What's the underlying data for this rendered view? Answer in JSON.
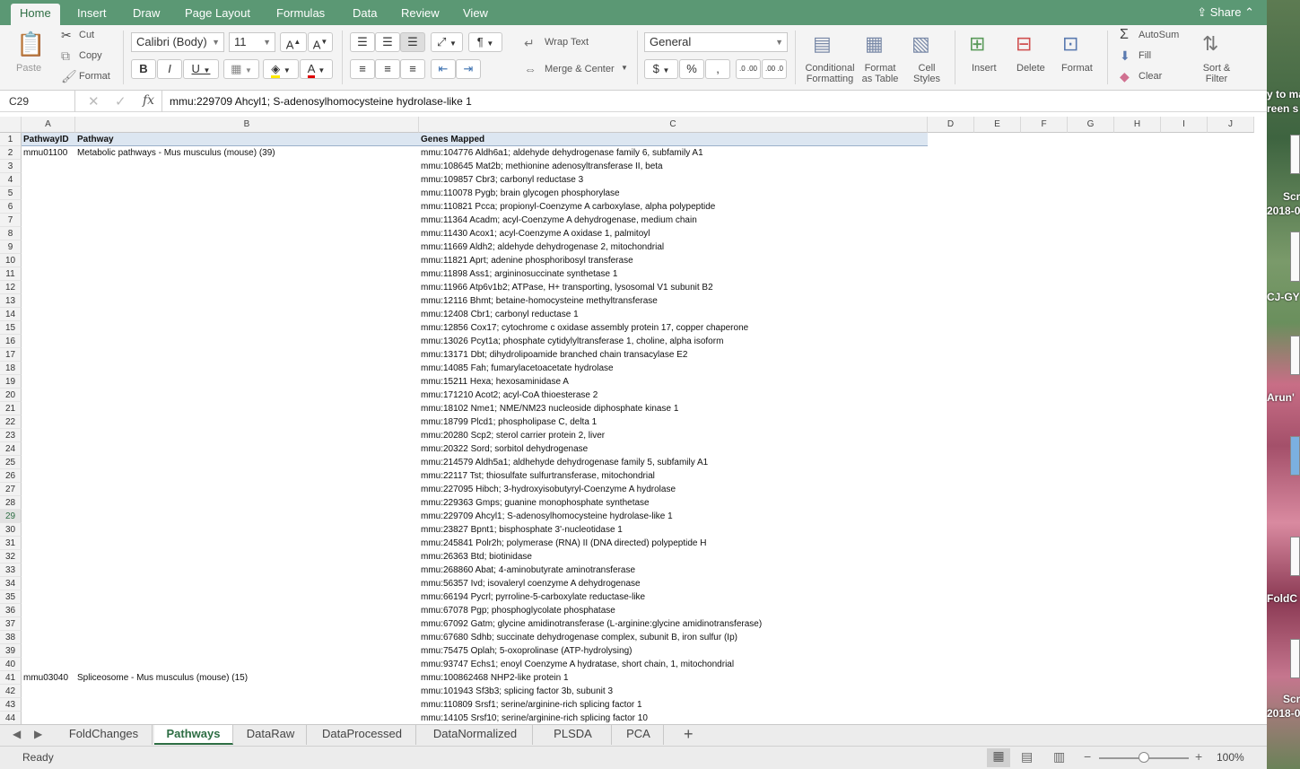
{
  "tabs": [
    "Home",
    "Insert",
    "Draw",
    "Page Layout",
    "Formulas",
    "Data",
    "Review",
    "View"
  ],
  "share": "Share",
  "ribbon": {
    "paste": "Paste",
    "cut": "Cut",
    "copy": "Copy",
    "format": "Format",
    "font_name": "Calibri (Body)",
    "font_size": "11",
    "wrap_text": "Wrap Text",
    "merge_center": "Merge & Center",
    "number_format": "General",
    "cond_fmt_1": "Conditional",
    "cond_fmt_2": "Formatting",
    "fmt_table_1": "Format",
    "fmt_table_2": "as Table",
    "cell_styles_1": "Cell",
    "cell_styles_2": "Styles",
    "insert": "Insert",
    "delete": "Delete",
    "format_cells": "Format",
    "autosum": "AutoSum",
    "fill": "Fill",
    "clear": "Clear",
    "sort_1": "Sort &",
    "sort_2": "Filter"
  },
  "formula_bar": {
    "name_box": "C29",
    "fx": "fx",
    "content": "mmu:229709 Ahcyl1; S-adenosylhomocysteine hydrolase-like 1"
  },
  "columns": [
    "A",
    "B",
    "C",
    "D",
    "E",
    "F",
    "G",
    "H",
    "I",
    "J"
  ],
  "header": {
    "a": "PathwayID",
    "b": "Pathway",
    "c": "Genes Mapped"
  },
  "rows": [
    {
      "n": "2",
      "a": "mmu01100",
      "b": "Metabolic pathways - Mus musculus (mouse) (39)",
      "c": "mmu:104776 Aldh6a1; aldehyde dehydrogenase family 6, subfamily A1"
    },
    {
      "n": "3",
      "a": "",
      "b": "",
      "c": "mmu:108645 Mat2b; methionine adenosyltransferase II, beta"
    },
    {
      "n": "4",
      "a": "",
      "b": "",
      "c": "mmu:109857 Cbr3; carbonyl reductase 3"
    },
    {
      "n": "5",
      "a": "",
      "b": "",
      "c": "mmu:110078 Pygb; brain glycogen phosphorylase"
    },
    {
      "n": "6",
      "a": "",
      "b": "",
      "c": "mmu:110821 Pcca; propionyl-Coenzyme A carboxylase, alpha polypeptide"
    },
    {
      "n": "7",
      "a": "",
      "b": "",
      "c": "mmu:11364 Acadm; acyl-Coenzyme A dehydrogenase, medium chain"
    },
    {
      "n": "8",
      "a": "",
      "b": "",
      "c": "mmu:11430 Acox1; acyl-Coenzyme A oxidase 1, palmitoyl"
    },
    {
      "n": "9",
      "a": "",
      "b": "",
      "c": "mmu:11669 Aldh2; aldehyde dehydrogenase 2, mitochondrial"
    },
    {
      "n": "10",
      "a": "",
      "b": "",
      "c": "mmu:11821 Aprt; adenine phosphoribosyl transferase"
    },
    {
      "n": "11",
      "a": "",
      "b": "",
      "c": "mmu:11898 Ass1; argininosuccinate synthetase 1"
    },
    {
      "n": "12",
      "a": "",
      "b": "",
      "c": "mmu:11966 Atp6v1b2; ATPase, H+ transporting, lysosomal V1 subunit B2"
    },
    {
      "n": "13",
      "a": "",
      "b": "",
      "c": "mmu:12116 Bhmt; betaine-homocysteine methyltransferase"
    },
    {
      "n": "14",
      "a": "",
      "b": "",
      "c": "mmu:12408 Cbr1; carbonyl reductase 1"
    },
    {
      "n": "15",
      "a": "",
      "b": "",
      "c": "mmu:12856 Cox17; cytochrome c oxidase assembly protein 17, copper chaperone"
    },
    {
      "n": "16",
      "a": "",
      "b": "",
      "c": "mmu:13026 Pcyt1a; phosphate cytidylyltransferase 1, choline, alpha isoform"
    },
    {
      "n": "17",
      "a": "",
      "b": "",
      "c": "mmu:13171 Dbt; dihydrolipoamide branched chain transacylase E2"
    },
    {
      "n": "18",
      "a": "",
      "b": "",
      "c": "mmu:14085 Fah; fumarylacetoacetate hydrolase"
    },
    {
      "n": "19",
      "a": "",
      "b": "",
      "c": "mmu:15211 Hexa; hexosaminidase A"
    },
    {
      "n": "20",
      "a": "",
      "b": "",
      "c": "mmu:171210 Acot2; acyl-CoA thioesterase 2"
    },
    {
      "n": "21",
      "a": "",
      "b": "",
      "c": "mmu:18102 Nme1; NME/NM23 nucleoside diphosphate kinase 1"
    },
    {
      "n": "22",
      "a": "",
      "b": "",
      "c": "mmu:18799 Plcd1; phospholipase C, delta 1"
    },
    {
      "n": "23",
      "a": "",
      "b": "",
      "c": "mmu:20280 Scp2; sterol carrier protein 2, liver"
    },
    {
      "n": "24",
      "a": "",
      "b": "",
      "c": "mmu:20322 Sord; sorbitol dehydrogenase"
    },
    {
      "n": "25",
      "a": "",
      "b": "",
      "c": "mmu:214579 Aldh5a1; aldhehyde dehydrogenase family 5, subfamily A1"
    },
    {
      "n": "26",
      "a": "",
      "b": "",
      "c": "mmu:22117 Tst; thiosulfate sulfurtransferase, mitochondrial"
    },
    {
      "n": "27",
      "a": "",
      "b": "",
      "c": "mmu:227095 Hibch; 3-hydroxyisobutyryl-Coenzyme A hydrolase"
    },
    {
      "n": "28",
      "a": "",
      "b": "",
      "c": "mmu:229363 Gmps; guanine monophosphate synthetase"
    },
    {
      "n": "29",
      "a": "",
      "b": "",
      "c": "mmu:229709 Ahcyl1; S-adenosylhomocysteine hydrolase-like 1"
    },
    {
      "n": "30",
      "a": "",
      "b": "",
      "c": "mmu:23827 Bpnt1; bisphosphate 3'-nucleotidase 1"
    },
    {
      "n": "31",
      "a": "",
      "b": "",
      "c": "mmu:245841 Polr2h; polymerase (RNA) II (DNA directed) polypeptide H"
    },
    {
      "n": "32",
      "a": "",
      "b": "",
      "c": "mmu:26363 Btd; biotinidase"
    },
    {
      "n": "33",
      "a": "",
      "b": "",
      "c": "mmu:268860 Abat; 4-aminobutyrate aminotransferase"
    },
    {
      "n": "34",
      "a": "",
      "b": "",
      "c": "mmu:56357 Ivd; isovaleryl coenzyme A dehydrogenase"
    },
    {
      "n": "35",
      "a": "",
      "b": "",
      "c": "mmu:66194 Pycrl; pyrroline-5-carboxylate reductase-like"
    },
    {
      "n": "36",
      "a": "",
      "b": "",
      "c": "mmu:67078 Pgp; phosphoglycolate phosphatase"
    },
    {
      "n": "37",
      "a": "",
      "b": "",
      "c": "mmu:67092 Gatm; glycine amidinotransferase (L-arginine:glycine amidinotransferase)"
    },
    {
      "n": "38",
      "a": "",
      "b": "",
      "c": "mmu:67680 Sdhb; succinate dehydrogenase complex, subunit B, iron sulfur (Ip)"
    },
    {
      "n": "39",
      "a": "",
      "b": "",
      "c": "mmu:75475 Oplah; 5-oxoprolinase (ATP-hydrolysing)"
    },
    {
      "n": "40",
      "a": "",
      "b": "",
      "c": "mmu:93747 Echs1; enoyl Coenzyme A hydratase, short chain, 1, mitochondrial"
    },
    {
      "n": "41",
      "a": "mmu03040",
      "b": "Spliceosome - Mus musculus (mouse) (15)",
      "c": "mmu:100862468 NHP2-like protein 1"
    },
    {
      "n": "42",
      "a": "",
      "b": "",
      "c": "mmu:101943 Sf3b3; splicing factor 3b, subunit 3"
    },
    {
      "n": "43",
      "a": "",
      "b": "",
      "c": "mmu:110809 Srsf1; serine/arginine-rich splicing factor 1"
    },
    {
      "n": "44",
      "a": "",
      "b": "",
      "c": "mmu:14105 Srsf10; serine/arginine-rich splicing factor 10"
    }
  ],
  "sheet_tabs": [
    "FoldChanges",
    "Pathways",
    "DataRaw",
    "DataProcessed",
    "DataNormalized",
    "PLSDA",
    "PCA"
  ],
  "active_sheet": "Pathways",
  "status": {
    "ready": "Ready",
    "zoom": "100%"
  },
  "desktop": {
    "l1": "y to ma",
    "l2": "reen s",
    "l3": "Scr",
    "l4": "2018-0",
    "l5": "CJ-GY",
    "l6": "Arun'",
    "l7": "FoldC",
    "l8": "Scr",
    "l9": "2018-0"
  },
  "colors": {
    "accent": "#5b9874",
    "header_fill": "#dce6f1",
    "active_tab_text": "#2e6e44"
  }
}
